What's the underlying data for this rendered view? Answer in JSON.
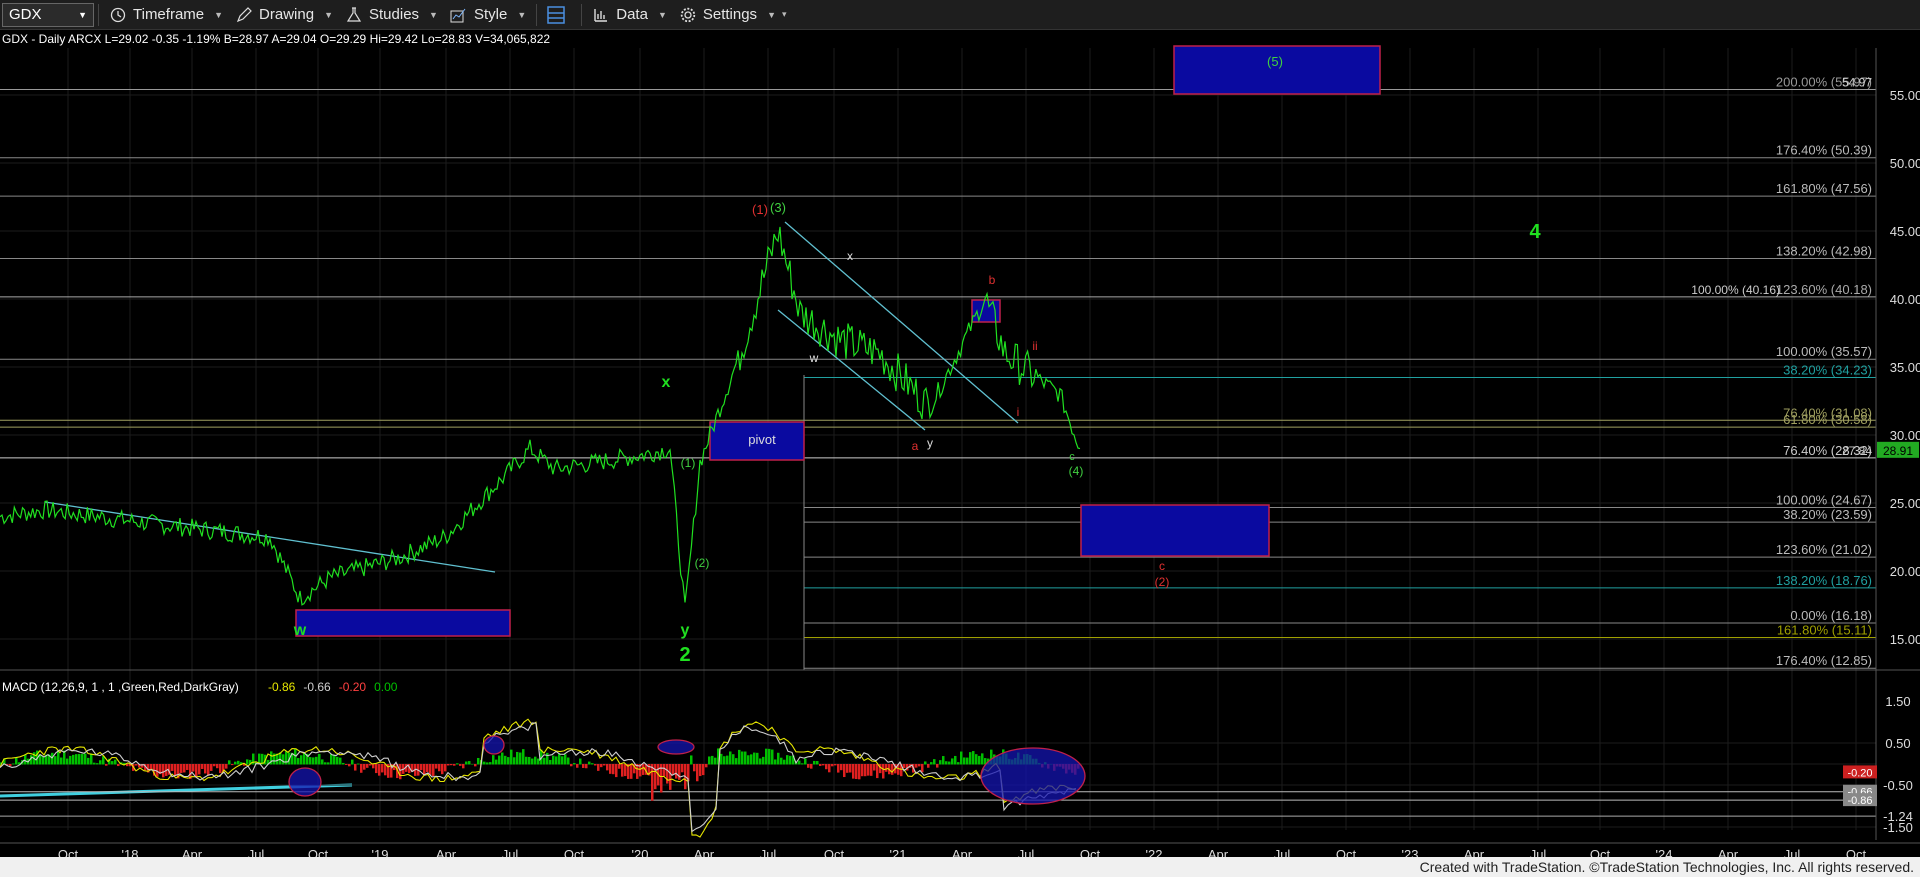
{
  "toolbar": {
    "symbol": "GDX",
    "items": [
      {
        "label": "Timeframe",
        "icon": "clock-icon"
      },
      {
        "label": "Drawing",
        "icon": "pencil-icon"
      },
      {
        "label": "Studies",
        "icon": "flask-icon"
      },
      {
        "label": "Style",
        "icon": "chart-style-icon"
      },
      {
        "label": "",
        "icon": "layout-icon"
      },
      {
        "label": "Data",
        "icon": "bar-chart-icon"
      },
      {
        "label": "Settings",
        "icon": "gear-icon"
      }
    ]
  },
  "price_info": "GDX - Daily  ARCX  L=29.02  -0.35  -1.19%  B=28.97  A=29.04  O=29.29  Hi=29.42  Lo=28.83  V=34,065,822",
  "macd_info": {
    "label": "MACD (12,26,9, 1 , 1 ,Green,Red,DarkGray)",
    "values": [
      "-0.86",
      "-0.66",
      "-0.20",
      "0.00"
    ],
    "colors": [
      "#e6e600",
      "#cfcfcf",
      "#ff4040",
      "#00c000"
    ]
  },
  "price_axis": [
    "55.00",
    "50.00",
    "45.00",
    "40.00",
    "35.00",
    "30.00",
    "25.00",
    "20.00",
    "15.00"
  ],
  "last_price": "28.91",
  "macd_axis": [
    "1.50",
    "0.50",
    "-0.50",
    "-1.24",
    "-1.50"
  ],
  "macd_markers": [
    "-0.66",
    "-0.86",
    "-0.20"
  ],
  "time_axis": [
    "Oct",
    "'18",
    "Apr",
    "Jul",
    "Oct",
    "'19",
    "Apr",
    "Jul",
    "Oct",
    "'20",
    "Apr",
    "Jul",
    "Oct",
    "'21",
    "Apr",
    "Jul",
    "Oct",
    "'22",
    "Apr",
    "Jul",
    "Oct",
    "'23",
    "Apr",
    "Jul",
    "Oct",
    "'24",
    "Apr",
    "Jul",
    "Oct"
  ],
  "fib_levels": [
    {
      "label": "200.00% (55.97)",
      "extra": "54.97",
      "price": 55.4,
      "color": "#999"
    },
    {
      "label": "176.40% (50.39)",
      "price": 50.39,
      "color": "#888"
    },
    {
      "label": "161.80% (47.56)",
      "price": 47.56,
      "color": "#888"
    },
    {
      "label": "138.20% (42.98)",
      "price": 42.98,
      "color": "#888"
    },
    {
      "label": "123.60% (40.18)",
      "extra": "100.00% (40.16)",
      "price": 40.16,
      "color": "#aaa"
    },
    {
      "label": "100.00% (35.57)",
      "price": 35.57,
      "color": "#888"
    },
    {
      "label": "38.20% (34.23)",
      "price": 34.23,
      "color": "#20a0a0"
    },
    {
      "label": "76.40% (31.08)",
      "price": 31.08,
      "color": "#a0a060"
    },
    {
      "label": "61.80% (30.58)",
      "price": 30.58,
      "color": "#a0a060"
    },
    {
      "label": "76.40% (28.32)",
      "extra": "27.84",
      "price": 28.32,
      "color": "#ccc"
    },
    {
      "label": "100.00% (24.67)",
      "price": 24.67,
      "color": "#888"
    },
    {
      "label": "38.20% (23.59)",
      "price": 23.59,
      "color": "#888"
    },
    {
      "label": "123.60% (21.02)",
      "price": 21.02,
      "color": "#888"
    },
    {
      "label": "138.20% (18.76)",
      "price": 18.76,
      "color": "#20a0a0"
    },
    {
      "label": "0.00% (16.18)",
      "price": 16.18,
      "color": "#888"
    },
    {
      "label": "161.80% (15.11)",
      "price": 15.11,
      "color": "#a0a000"
    },
    {
      "label": "176.40% (12.85)",
      "price": 12.85,
      "color": "#888"
    }
  ],
  "wave_labels": [
    {
      "text": "(5)",
      "color": "#40d040"
    },
    {
      "text": "(1)",
      "color": "#e03030"
    },
    {
      "text": "(3)",
      "color": "#40d040"
    },
    {
      "text": "x",
      "color": "#ddd"
    },
    {
      "text": "4",
      "color": "#20e020"
    },
    {
      "text": "b",
      "color": "#e03030"
    },
    {
      "text": "ii",
      "color": "#e03030"
    },
    {
      "text": "w",
      "color": "#ddd"
    },
    {
      "text": "i",
      "color": "#e03030"
    },
    {
      "text": "x",
      "color": "#20e020"
    },
    {
      "text": "a",
      "color": "#e03030"
    },
    {
      "text": "y",
      "color": "#ddd"
    },
    {
      "text": "c",
      "color": "#40d040"
    },
    {
      "text": "(4)",
      "color": "#40d040"
    },
    {
      "text": "(1)",
      "color": "#40d040"
    },
    {
      "text": "(2)",
      "color": "#40d040"
    },
    {
      "text": "c",
      "color": "#e03030"
    },
    {
      "text": "(2)",
      "color": "#e03030"
    },
    {
      "text": "w",
      "color": "#20e020"
    },
    {
      "text": "y",
      "color": "#20e020"
    },
    {
      "text": "2",
      "color": "#20e020"
    }
  ],
  "pivot_label": "pivot",
  "footer": "Created with TradeStation. ©TradeStation Technologies, Inc. All rights reserved.",
  "chart_data": {
    "type": "line",
    "title": "GDX - Daily",
    "price_range": [
      12,
      58
    ],
    "macd_range": [
      -1.8,
      1.9
    ],
    "x": [
      "2017-Oct",
      "2018-Jan",
      "2018-Apr",
      "2018-Jul",
      "2018-Sep",
      "2018-Oct",
      "2019-Jan",
      "2019-Apr",
      "2019-Jun",
      "2019-Aug",
      "2019-Oct",
      "2020-Jan",
      "2020-Feb",
      "2020-Mar",
      "2020-Apr",
      "2020-May",
      "2020-Jun",
      "2020-Aug",
      "2020-Oct",
      "2020-Nov",
      "2021-Jan",
      "2021-Mar",
      "2021-May",
      "2021-Jun",
      "2021-Jul",
      "2021-Aug",
      "2021-Sep"
    ],
    "series": [
      {
        "values": [
          24,
          24.5,
          23.5,
          22.5,
          18,
          19.5,
          21,
          22.5,
          27,
          29,
          27.5,
          28.5,
          29,
          17,
          28,
          32,
          36,
          45,
          39,
          37,
          36,
          32,
          40,
          36,
          34,
          33,
          29
        ]
      }
    ]
  }
}
